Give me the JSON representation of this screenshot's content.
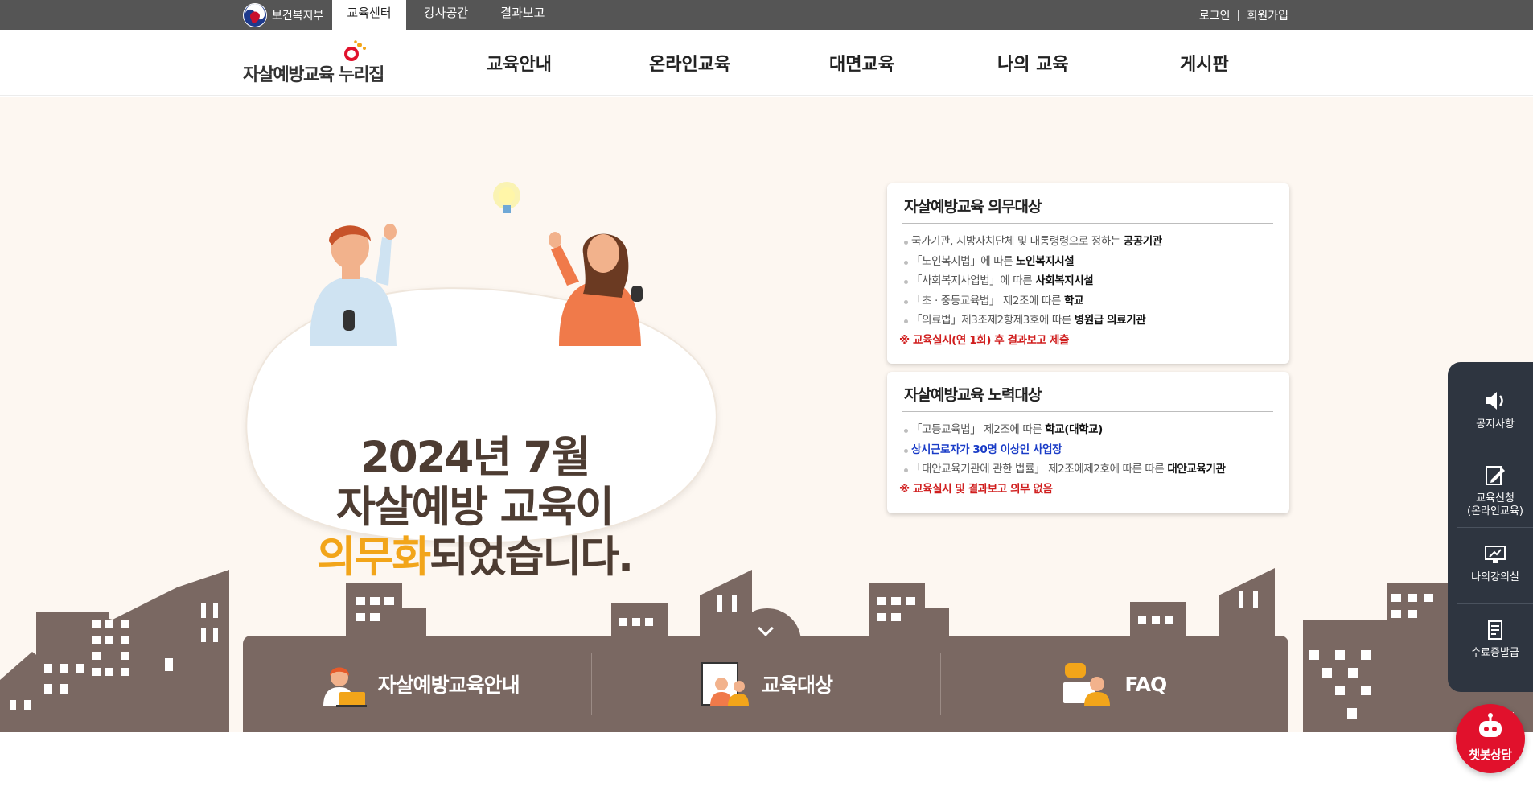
{
  "topbar": {
    "gov_name": "보건복지부",
    "tabs": [
      {
        "label": "교육센터",
        "active": true
      },
      {
        "label": "강사공간",
        "active": false
      },
      {
        "label": "결과보고",
        "active": false
      }
    ],
    "login": "로그인",
    "signup": "회원가입"
  },
  "header": {
    "logo_text": "자살예방교육 누리집",
    "nav": [
      "교육안내",
      "온라인교육",
      "대면교육",
      "나의 교육",
      "게시판"
    ]
  },
  "hero": {
    "line1": "2024년 7월",
    "line2": "자살예방 교육이",
    "line3_highlight": "의무화",
    "line3_rest": "되었습니다."
  },
  "cards": [
    {
      "title": "자살예방교육 의무대상",
      "items": [
        {
          "text": "국가기관, 지방자치단체 및 대통령령으로 정하는 ",
          "bold": "공공기관"
        },
        {
          "text": "「노인복지법」에 따른 ",
          "bold": "노인복지시설"
        },
        {
          "text": "「사회복지사업법」에 따른 ",
          "bold": "사회복지시설"
        },
        {
          "text": "「초 · 중등교육법」 제2조에 따른 ",
          "bold": "학교"
        },
        {
          "text": "「의료법」제3조제2항제3호에 따른 ",
          "bold": "병원급 의료기관"
        }
      ],
      "note": "※ 교육실시(연 1회) 후 결과보고 제출"
    },
    {
      "title": "자살예방교육 노력대상",
      "items": [
        {
          "text": "「고등교육법」 제2조에 따른 ",
          "bold": "학교(대학교)"
        },
        {
          "text": "상시근로자가 30명 이상인 사업장",
          "bold": ""
        },
        {
          "text": "「대안교육기관에 관한 법률」 제2조에제2호에 따른 따른 ",
          "bold": "대안교육기관"
        }
      ],
      "note": "※ 교육실시 및 결과보고 의무 없음"
    }
  ],
  "quick": [
    {
      "label": "자살예방교육안내",
      "icon": "counselor-laptop-icon"
    },
    {
      "label": "교육대상",
      "icon": "people-document-icon"
    },
    {
      "label": "FAQ",
      "icon": "faq-person-icon"
    }
  ],
  "side_menu": [
    {
      "label": "공지사항",
      "icon": "speaker-icon"
    },
    {
      "label": "교육신청\n(온라인교육)",
      "label1": "교육신청",
      "label2": "(온라인교육)",
      "icon": "edit-document-icon"
    },
    {
      "label": "나의강의실",
      "icon": "monitor-icon"
    },
    {
      "label": "수료증발급",
      "icon": "certificate-icon"
    }
  ],
  "chatbot": {
    "label": "챗봇상담",
    "icon": "robot-icon"
  },
  "colors": {
    "topbar": "#555555",
    "hero_bg": "#fdf7f1",
    "building": "#7a6862",
    "highlight": "#f2a51a",
    "side_menu": "#2e3540",
    "chatbot": "#e1112c",
    "note_red": "#d01e1e",
    "blue_text": "#1a3cc7"
  }
}
